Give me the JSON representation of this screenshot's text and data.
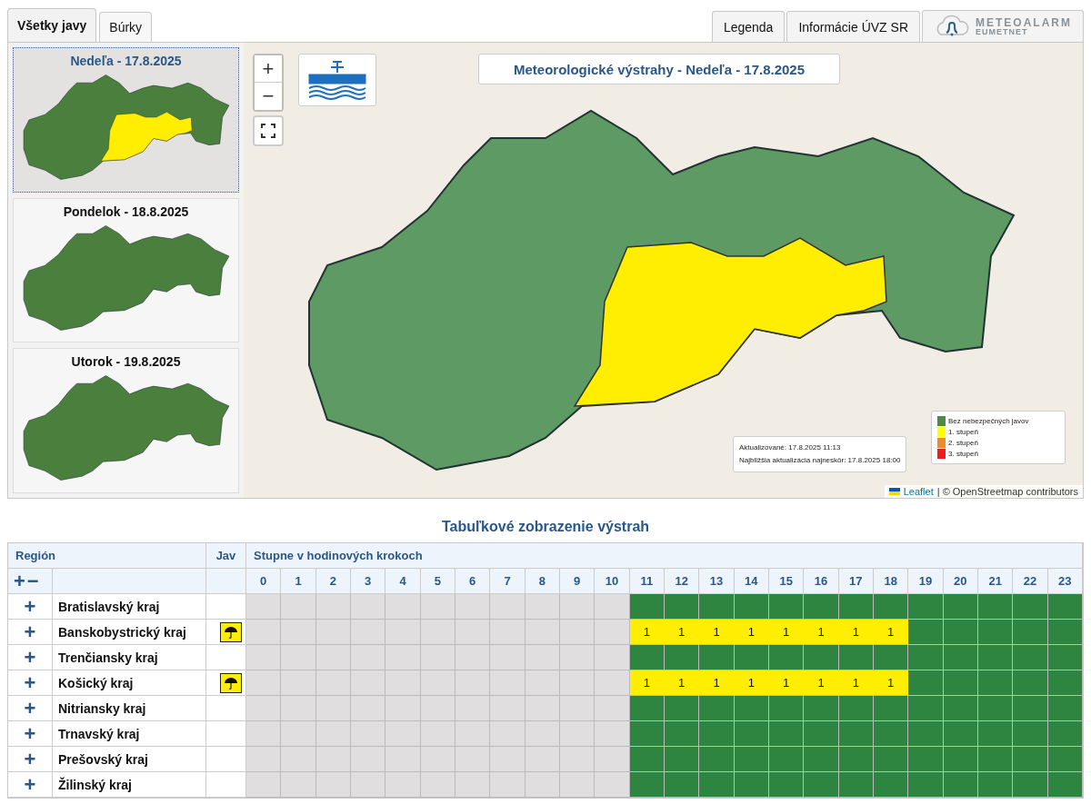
{
  "tabs": [
    {
      "label": "Všetky javy",
      "selected": true
    },
    {
      "label": "Búrky",
      "selected": false
    }
  ],
  "top_buttons": [
    {
      "label": "Legenda"
    },
    {
      "label": "Informácie ÚVZ SR"
    }
  ],
  "meteoalarm": {
    "name": "METEOALARM",
    "sub": "EUMETNET"
  },
  "days": [
    {
      "title": "Nedeľa - 17.8.2025",
      "selected": true,
      "warning": true
    },
    {
      "title": "Pondelok - 18.8.2025",
      "selected": false,
      "warning": false
    },
    {
      "title": "Utorok - 19.8.2025",
      "selected": false,
      "warning": false
    }
  ],
  "map": {
    "zoom_in": "+",
    "zoom_out": "−",
    "title": "Meteorologické výstrahy - Nedeľa - 17.8.2025",
    "updated": "Aktualizované: 17.8.2025 11:13",
    "next_update": "Najbližšia aktualizácia najneskôr: 17.8.2025 18:00",
    "legend": [
      {
        "label": "Bez nebezpečných javov",
        "color": "#4e8a4a"
      },
      {
        "label": "1. stupeň",
        "color": "#ffff00"
      },
      {
        "label": "2. stupeň",
        "color": "#f08a30"
      },
      {
        "label": "3. stupeň",
        "color": "#ee1c1c"
      }
    ],
    "attribution_link": "Leaflet",
    "attribution_text": "| © OpenStreetmap contributors"
  },
  "table": {
    "title": "Tabuľkové zobrazenie výstrah",
    "col_region": "Región",
    "col_jav": "Jav",
    "col_hours": "Stupne v hodinových krokoch",
    "expand_all": "+",
    "collapse_all": "−",
    "hours": [
      "0",
      "1",
      "2",
      "3",
      "4",
      "5",
      "6",
      "7",
      "8",
      "9",
      "10",
      "11",
      "12",
      "13",
      "14",
      "15",
      "16",
      "17",
      "18",
      "19",
      "20",
      "21",
      "22",
      "23"
    ],
    "rows": [
      {
        "expand": "+",
        "region": "Bratislavský kraj",
        "cells": [
          {
            "kind": "past"
          },
          {
            "kind": "past"
          },
          {
            "kind": "past"
          },
          {
            "kind": "past"
          },
          {
            "kind": "past"
          },
          {
            "kind": "past"
          },
          {
            "kind": "past"
          },
          {
            "kind": "past"
          },
          {
            "kind": "past"
          },
          {
            "kind": "past"
          },
          {
            "kind": "past"
          },
          {
            "kind": "none"
          },
          {
            "kind": "none"
          },
          {
            "kind": "none"
          },
          {
            "kind": "none"
          },
          {
            "kind": "none"
          },
          {
            "kind": "none"
          },
          {
            "kind": "none"
          },
          {
            "kind": "none"
          },
          {
            "kind": "none"
          },
          {
            "kind": "none"
          },
          {
            "kind": "none"
          },
          {
            "kind": "none"
          },
          {
            "kind": "none"
          }
        ]
      },
      {
        "expand": "+",
        "region": "Banskobystrický kraj",
        "warning_icon": true,
        "cells": [
          {
            "kind": "past"
          },
          {
            "kind": "past"
          },
          {
            "kind": "past"
          },
          {
            "kind": "past"
          },
          {
            "kind": "past"
          },
          {
            "kind": "past"
          },
          {
            "kind": "past"
          },
          {
            "kind": "past"
          },
          {
            "kind": "past"
          },
          {
            "kind": "past"
          },
          {
            "kind": "past"
          },
          {
            "kind": "warning",
            "text": "1"
          },
          {
            "kind": "warning",
            "text": "1"
          },
          {
            "kind": "warning",
            "text": "1"
          },
          {
            "kind": "warning",
            "text": "1"
          },
          {
            "kind": "warning",
            "text": "1"
          },
          {
            "kind": "warning",
            "text": "1"
          },
          {
            "kind": "warning",
            "text": "1"
          },
          {
            "kind": "warning",
            "text": "1"
          },
          {
            "kind": "none"
          },
          {
            "kind": "none"
          },
          {
            "kind": "none"
          },
          {
            "kind": "none"
          },
          {
            "kind": "none"
          }
        ]
      },
      {
        "expand": "+",
        "region": "Trenčiansky kraj",
        "cells": [
          {
            "kind": "past"
          },
          {
            "kind": "past"
          },
          {
            "kind": "past"
          },
          {
            "kind": "past"
          },
          {
            "kind": "past"
          },
          {
            "kind": "past"
          },
          {
            "kind": "past"
          },
          {
            "kind": "past"
          },
          {
            "kind": "past"
          },
          {
            "kind": "past"
          },
          {
            "kind": "past"
          },
          {
            "kind": "none"
          },
          {
            "kind": "none"
          },
          {
            "kind": "none"
          },
          {
            "kind": "none"
          },
          {
            "kind": "none"
          },
          {
            "kind": "none"
          },
          {
            "kind": "none"
          },
          {
            "kind": "none"
          },
          {
            "kind": "none"
          },
          {
            "kind": "none"
          },
          {
            "kind": "none"
          },
          {
            "kind": "none"
          },
          {
            "kind": "none"
          }
        ]
      },
      {
        "expand": "+",
        "region": "Košický kraj",
        "warning_icon": true,
        "cells": [
          {
            "kind": "past"
          },
          {
            "kind": "past"
          },
          {
            "kind": "past"
          },
          {
            "kind": "past"
          },
          {
            "kind": "past"
          },
          {
            "kind": "past"
          },
          {
            "kind": "past"
          },
          {
            "kind": "past"
          },
          {
            "kind": "past"
          },
          {
            "kind": "past"
          },
          {
            "kind": "past"
          },
          {
            "kind": "warning",
            "text": "1"
          },
          {
            "kind": "warning",
            "text": "1"
          },
          {
            "kind": "warning",
            "text": "1"
          },
          {
            "kind": "warning",
            "text": "1"
          },
          {
            "kind": "warning",
            "text": "1"
          },
          {
            "kind": "warning",
            "text": "1"
          },
          {
            "kind": "warning",
            "text": "1"
          },
          {
            "kind": "warning",
            "text": "1"
          },
          {
            "kind": "none"
          },
          {
            "kind": "none"
          },
          {
            "kind": "none"
          },
          {
            "kind": "none"
          },
          {
            "kind": "none"
          }
        ]
      },
      {
        "expand": "+",
        "region": "Nitriansky kraj",
        "cells": [
          {
            "kind": "past"
          },
          {
            "kind": "past"
          },
          {
            "kind": "past"
          },
          {
            "kind": "past"
          },
          {
            "kind": "past"
          },
          {
            "kind": "past"
          },
          {
            "kind": "past"
          },
          {
            "kind": "past"
          },
          {
            "kind": "past"
          },
          {
            "kind": "past"
          },
          {
            "kind": "past"
          },
          {
            "kind": "none"
          },
          {
            "kind": "none"
          },
          {
            "kind": "none"
          },
          {
            "kind": "none"
          },
          {
            "kind": "none"
          },
          {
            "kind": "none"
          },
          {
            "kind": "none"
          },
          {
            "kind": "none"
          },
          {
            "kind": "none"
          },
          {
            "kind": "none"
          },
          {
            "kind": "none"
          },
          {
            "kind": "none"
          },
          {
            "kind": "none"
          }
        ]
      },
      {
        "expand": "+",
        "region": "Trnavský kraj",
        "cells": [
          {
            "kind": "past"
          },
          {
            "kind": "past"
          },
          {
            "kind": "past"
          },
          {
            "kind": "past"
          },
          {
            "kind": "past"
          },
          {
            "kind": "past"
          },
          {
            "kind": "past"
          },
          {
            "kind": "past"
          },
          {
            "kind": "past"
          },
          {
            "kind": "past"
          },
          {
            "kind": "past"
          },
          {
            "kind": "none"
          },
          {
            "kind": "none"
          },
          {
            "kind": "none"
          },
          {
            "kind": "none"
          },
          {
            "kind": "none"
          },
          {
            "kind": "none"
          },
          {
            "kind": "none"
          },
          {
            "kind": "none"
          },
          {
            "kind": "none"
          },
          {
            "kind": "none"
          },
          {
            "kind": "none"
          },
          {
            "kind": "none"
          },
          {
            "kind": "none"
          }
        ]
      },
      {
        "expand": "+",
        "region": "Prešovský kraj",
        "cells": [
          {
            "kind": "past"
          },
          {
            "kind": "past"
          },
          {
            "kind": "past"
          },
          {
            "kind": "past"
          },
          {
            "kind": "past"
          },
          {
            "kind": "past"
          },
          {
            "kind": "past"
          },
          {
            "kind": "past"
          },
          {
            "kind": "past"
          },
          {
            "kind": "past"
          },
          {
            "kind": "past"
          },
          {
            "kind": "none"
          },
          {
            "kind": "none"
          },
          {
            "kind": "none"
          },
          {
            "kind": "none"
          },
          {
            "kind": "none"
          },
          {
            "kind": "none"
          },
          {
            "kind": "none"
          },
          {
            "kind": "none"
          },
          {
            "kind": "none"
          },
          {
            "kind": "none"
          },
          {
            "kind": "none"
          },
          {
            "kind": "none"
          },
          {
            "kind": "none"
          }
        ]
      },
      {
        "expand": "+",
        "region": "Žilinský kraj",
        "cells": [
          {
            "kind": "past"
          },
          {
            "kind": "past"
          },
          {
            "kind": "past"
          },
          {
            "kind": "past"
          },
          {
            "kind": "past"
          },
          {
            "kind": "past"
          },
          {
            "kind": "past"
          },
          {
            "kind": "past"
          },
          {
            "kind": "past"
          },
          {
            "kind": "past"
          },
          {
            "kind": "past"
          },
          {
            "kind": "none"
          },
          {
            "kind": "none"
          },
          {
            "kind": "none"
          },
          {
            "kind": "none"
          },
          {
            "kind": "none"
          },
          {
            "kind": "none"
          },
          {
            "kind": "none"
          },
          {
            "kind": "none"
          },
          {
            "kind": "none"
          },
          {
            "kind": "none"
          },
          {
            "kind": "none"
          },
          {
            "kind": "none"
          },
          {
            "kind": "none"
          }
        ]
      }
    ]
  }
}
